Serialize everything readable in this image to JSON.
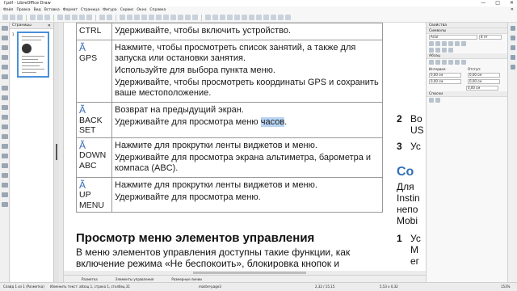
{
  "window": {
    "title": "f.pdf - LibreOffice Draw",
    "controls": [
      "—",
      "□",
      "✕"
    ]
  },
  "menu": [
    "Файл",
    "Правка",
    "Вид",
    "Вставка",
    "Формат",
    "Страница",
    "Фигура",
    "Сервис",
    "Окно",
    "Справка"
  ],
  "menu_close": "✕",
  "pages_panel": {
    "title": "Страницы",
    "page_number": "1"
  },
  "table": [
    {
      "key_glyph": "",
      "key": "CTRL",
      "desc": [
        "Удерживайте, чтобы включить устройство."
      ]
    },
    {
      "key_glyph": "Ã",
      "key": "GPS",
      "desc": [
        "Нажмите, чтобы просмотреть список занятий, а также для запуска или остановки занятия.",
        "Используйте для выбора пункта меню.",
        "Удерживайте, чтобы просмотреть координаты GPS и сохранить ваше местоположение."
      ]
    },
    {
      "key_glyph": "Ã",
      "key": "BACK SET",
      "desc": [
        "Возврат на предыдущий экран."
      ],
      "desc_last_pre": "Удерживайте для просмотра меню ",
      "desc_last_hl": "часов",
      "desc_last_post": "."
    },
    {
      "key_glyph": "Ã",
      "key": "DOWN ABC",
      "desc": [
        "Нажмите для прокрутки ленты виджетов и меню.",
        "Удерживайте для просмотра экрана альтиметра, барометра и компаса (ABC)."
      ]
    },
    {
      "key_glyph": "Ã",
      "key": "UP MENU",
      "desc": [
        "Нажмите для прокрутки ленты виджетов и меню.",
        "Удерживайте для просмотра меню."
      ]
    }
  ],
  "section_heading": "Просмотр меню элементов управления",
  "section_text": "В меню элементов управления доступны такие функции, как включение режима «Не беспокоить», блокировка кнопок и отключение устройства.",
  "right_column": {
    "item2_num": "2",
    "item2_text": "Во",
    "item2_text2": "US",
    "item3_num": "3",
    "item3_text": "Ус",
    "heading": "Co",
    "lines": [
      "Для",
      "Instin",
      "непо",
      "Mobi"
    ],
    "item1_num": "1",
    "item1_text": "Ус",
    "item1_text2": "M",
    "item1_text3": "ег"
  },
  "doc_tabs": [
    "Разметка",
    "Элементы управления",
    "Размерные линии"
  ],
  "sidebar": {
    "properties": "Свойства",
    "symbols": "Символы",
    "font_name": "Arial",
    "font_size": "8 пт",
    "paragraph": "Абзац",
    "spacing_label": "Интервал:",
    "indent_label": "Отступ:",
    "val1": "0,00 см",
    "val2": "0,00 см",
    "val3": "0,00 см",
    "val4": "0,00 см",
    "val5": "0,00 см",
    "lists": "Списки"
  },
  "status": {
    "slide": "Слайд 1 из 1 (Разметка)",
    "edit": "Изменить текст: абзац 1, строка 1, столбец 31",
    "master": "master-page3",
    "pos": "2,32 / 15,15",
    "size": "5,53 x 0,32",
    "zoom": "153%"
  }
}
